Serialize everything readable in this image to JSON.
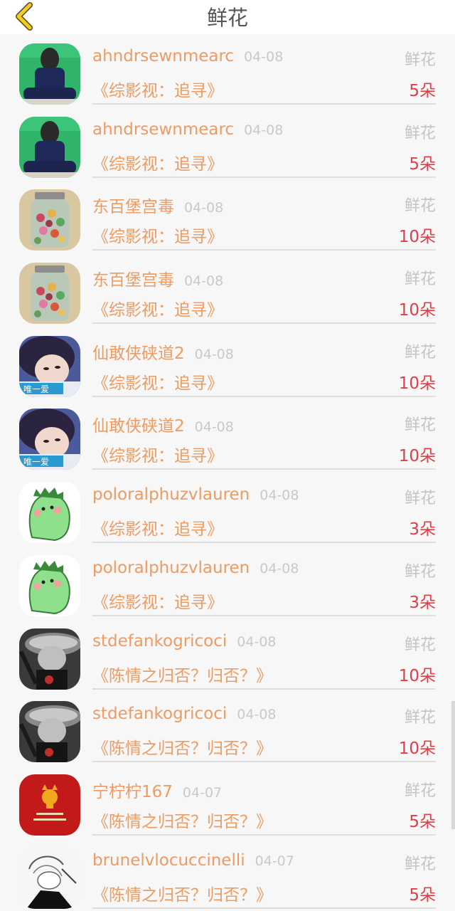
{
  "header": {
    "title": "鲜花",
    "back_icon": "chevron-left-icon",
    "back_color": "#f2cc25"
  },
  "colors": {
    "accent": "#ec9c62",
    "count": "#e23c46",
    "muted": "#c4c4c4"
  },
  "items": [
    {
      "username": "ahndrsewnmearc",
      "date": "04-08",
      "gift_type": "鲜花",
      "book": "《综影视：追寻》",
      "count": "5朵",
      "avatar": "green-photo"
    },
    {
      "username": "ahndrsewnmearc",
      "date": "04-08",
      "gift_type": "鲜花",
      "book": "《综影视：追寻》",
      "count": "5朵",
      "avatar": "green-photo"
    },
    {
      "username": "东百堡宫毒",
      "date": "04-08",
      "gift_type": "鲜花",
      "book": "《综影视：追寻》",
      "count": "10朵",
      "avatar": "jar"
    },
    {
      "username": "东百堡宫毒",
      "date": "04-08",
      "gift_type": "鲜花",
      "book": "《综影视：追寻》",
      "count": "10朵",
      "avatar": "jar"
    },
    {
      "username": "仙敢侠硖道2",
      "date": "04-08",
      "gift_type": "鲜花",
      "book": "《综影视：追寻》",
      "count": "10朵",
      "avatar": "girl",
      "avatar_label": "唯一爱"
    },
    {
      "username": "仙敢侠硖道2",
      "date": "04-08",
      "gift_type": "鲜花",
      "book": "《综影视：追寻》",
      "count": "10朵",
      "avatar": "girl",
      "avatar_label": "唯一爱"
    },
    {
      "username": "poloralphuzvlauren",
      "date": "04-08",
      "gift_type": "鲜花",
      "book": "《综影视：追寻》",
      "count": "3朵",
      "avatar": "cactus"
    },
    {
      "username": "poloralphuzvlauren",
      "date": "04-08",
      "gift_type": "鲜花",
      "book": "《综影视：追寻》",
      "count": "3朵",
      "avatar": "cactus"
    },
    {
      "username": "stdefankogricoci",
      "date": "04-08",
      "gift_type": "鲜花",
      "book": "《陈情之归否？归否？》",
      "count": "10朵",
      "avatar": "sketch-dark"
    },
    {
      "username": "stdefankogricoci",
      "date": "04-08",
      "gift_type": "鲜花",
      "book": "《陈情之归否？归否？》",
      "count": "10朵",
      "avatar": "sketch-dark"
    },
    {
      "username": "宁柠柠167",
      "date": "04-07",
      "gift_type": "鲜花",
      "book": "《陈情之归否？归否？》",
      "count": "5朵",
      "avatar": "red-card"
    },
    {
      "username": "brunelvlocuccinelli",
      "date": "04-07",
      "gift_type": "鲜花",
      "book": "《陈情之归否？归否？》",
      "count": "5朵",
      "avatar": "sketch-light"
    }
  ]
}
